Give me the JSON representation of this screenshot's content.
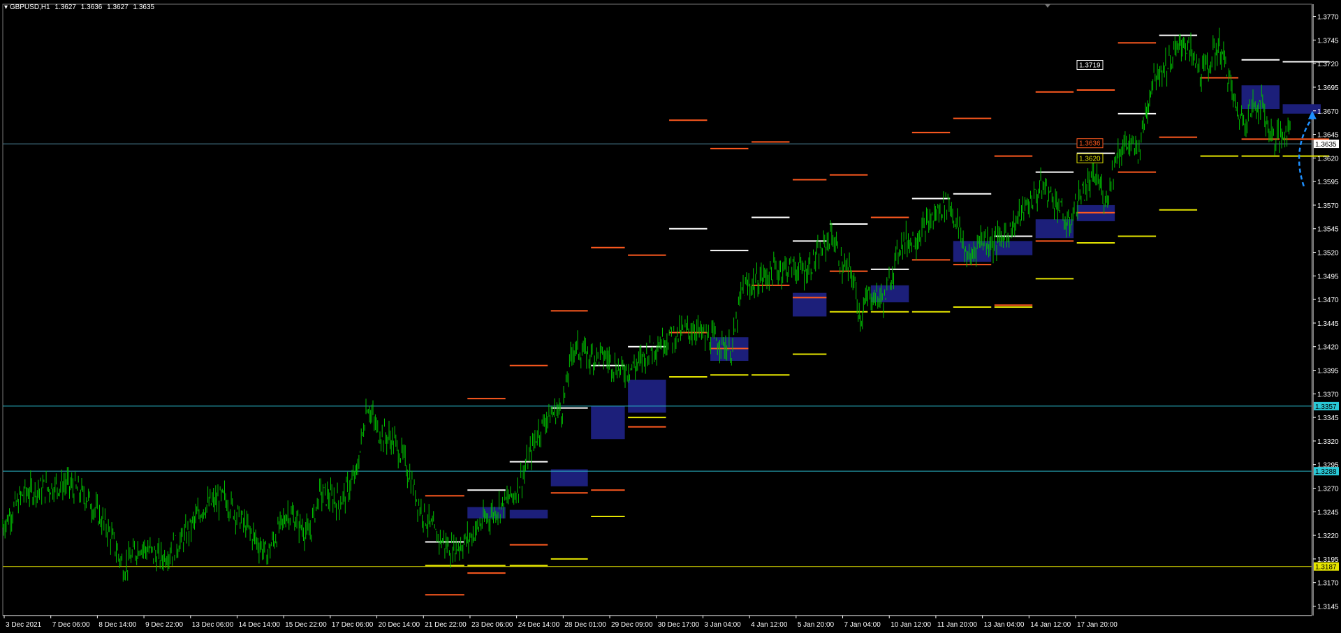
{
  "header": {
    "symbol": "GBPUSD,H1",
    "open": "1.3627",
    "high": "1.3636",
    "low": "1.3627",
    "close": "1.3635"
  },
  "colors": {
    "background": "#000000",
    "candles": "#00c000",
    "axis": "#ffffff",
    "hline_cyan": "#29b6c8",
    "hline_yellow": "#e5e500",
    "level_white": "#ffffff",
    "level_orange": "#ff5a1f",
    "level_yellow": "#e5e500",
    "zone": "#1c1f7a",
    "arrow": "#1e90ff"
  },
  "chart_data": {
    "type": "candlestick",
    "instrument": "GBPUSD",
    "timeframe": "H1",
    "y_ticks": [
      "1.3770",
      "1.3745",
      "1.3720",
      "1.3695",
      "1.3670",
      "1.3645",
      "1.3620",
      "1.3595",
      "1.3570",
      "1.3545",
      "1.3520",
      "1.3495",
      "1.3470",
      "1.3445",
      "1.3420",
      "1.3395",
      "1.3370",
      "1.3345",
      "1.3320",
      "1.3295",
      "1.3270",
      "1.3245",
      "1.3220",
      "1.3195",
      "1.3170",
      "1.3145"
    ],
    "y_range": [
      1.3135,
      1.3783
    ],
    "x_ticks": [
      "3 Dec 2021",
      "7 Dec 06:00",
      "8 Dec 14:00",
      "9 Dec 22:00",
      "13 Dec 06:00",
      "14 Dec 14:00",
      "15 Dec 22:00",
      "17 Dec 06:00",
      "20 Dec 14:00",
      "21 Dec 22:00",
      "23 Dec 06:00",
      "24 Dec 14:00",
      "28 Dec 01:00",
      "29 Dec 09:00",
      "30 Dec 17:00",
      "3 Jan 04:00",
      "4 Jan 12:00",
      "5 Jan 20:00",
      "7 Jan 04:00",
      "10 Jan 12:00",
      "11 Jan 20:00",
      "13 Jan 04:00",
      "14 Jan 12:00",
      "17 Jan 20:00"
    ],
    "price_path": [
      {
        "x": 0,
        "y": 1.323
      },
      {
        "x": 20,
        "y": 1.3265
      },
      {
        "x": 40,
        "y": 1.327
      },
      {
        "x": 60,
        "y": 1.3275
      },
      {
        "x": 80,
        "y": 1.326
      },
      {
        "x": 100,
        "y": 1.3225
      },
      {
        "x": 115,
        "y": 1.3185
      },
      {
        "x": 130,
        "y": 1.321
      },
      {
        "x": 150,
        "y": 1.3195
      },
      {
        "x": 170,
        "y": 1.3215
      },
      {
        "x": 190,
        "y": 1.325
      },
      {
        "x": 210,
        "y": 1.326
      },
      {
        "x": 230,
        "y": 1.323
      },
      {
        "x": 250,
        "y": 1.32
      },
      {
        "x": 270,
        "y": 1.3245
      },
      {
        "x": 290,
        "y": 1.322
      },
      {
        "x": 300,
        "y": 1.3265
      },
      {
        "x": 320,
        "y": 1.3255
      },
      {
        "x": 335,
        "y": 1.3285
      },
      {
        "x": 345,
        "y": 1.336
      },
      {
        "x": 355,
        "y": 1.333
      },
      {
        "x": 370,
        "y": 1.332
      },
      {
        "x": 380,
        "y": 1.33
      },
      {
        "x": 395,
        "y": 1.325
      },
      {
        "x": 410,
        "y": 1.322
      },
      {
        "x": 425,
        "y": 1.3205
      },
      {
        "x": 440,
        "y": 1.3215
      },
      {
        "x": 455,
        "y": 1.3235
      },
      {
        "x": 470,
        "y": 1.325
      },
      {
        "x": 485,
        "y": 1.3265
      },
      {
        "x": 495,
        "y": 1.329
      },
      {
        "x": 505,
        "y": 1.3325
      },
      {
        "x": 515,
        "y": 1.3345
      },
      {
        "x": 530,
        "y": 1.3355
      },
      {
        "x": 540,
        "y": 1.342
      },
      {
        "x": 555,
        "y": 1.341
      },
      {
        "x": 570,
        "y": 1.341
      },
      {
        "x": 585,
        "y": 1.3395
      },
      {
        "x": 600,
        "y": 1.34
      },
      {
        "x": 615,
        "y": 1.342
      },
      {
        "x": 630,
        "y": 1.343
      },
      {
        "x": 645,
        "y": 1.3435
      },
      {
        "x": 655,
        "y": 1.344
      },
      {
        "x": 665,
        "y": 1.343
      },
      {
        "x": 680,
        "y": 1.3425
      },
      {
        "x": 690,
        "y": 1.3415
      },
      {
        "x": 700,
        "y": 1.348
      },
      {
        "x": 715,
        "y": 1.349
      },
      {
        "x": 730,
        "y": 1.35
      },
      {
        "x": 745,
        "y": 1.3505
      },
      {
        "x": 760,
        "y": 1.35
      },
      {
        "x": 775,
        "y": 1.352
      },
      {
        "x": 785,
        "y": 1.354
      },
      {
        "x": 795,
        "y": 1.3505
      },
      {
        "x": 805,
        "y": 1.3495
      },
      {
        "x": 812,
        "y": 1.345
      },
      {
        "x": 820,
        "y": 1.3475
      },
      {
        "x": 835,
        "y": 1.347
      },
      {
        "x": 850,
        "y": 1.353
      },
      {
        "x": 865,
        "y": 1.3535
      },
      {
        "x": 880,
        "y": 1.3555
      },
      {
        "x": 895,
        "y": 1.3575
      },
      {
        "x": 905,
        "y": 1.3545
      },
      {
        "x": 915,
        "y": 1.351
      },
      {
        "x": 925,
        "y": 1.3535
      },
      {
        "x": 940,
        "y": 1.353
      },
      {
        "x": 955,
        "y": 1.3545
      },
      {
        "x": 970,
        "y": 1.357
      },
      {
        "x": 985,
        "y": 1.359
      },
      {
        "x": 1000,
        "y": 1.357
      },
      {
        "x": 1008,
        "y": 1.3545
      },
      {
        "x": 1020,
        "y": 1.358
      },
      {
        "x": 1035,
        "y": 1.36
      },
      {
        "x": 1045,
        "y": 1.3575
      },
      {
        "x": 1055,
        "y": 1.3625
      },
      {
        "x": 1065,
        "y": 1.3635
      },
      {
        "x": 1075,
        "y": 1.3625
      },
      {
        "x": 1082,
        "y": 1.3665
      },
      {
        "x": 1090,
        "y": 1.371
      },
      {
        "x": 1100,
        "y": 1.3715
      },
      {
        "x": 1110,
        "y": 1.373
      },
      {
        "x": 1118,
        "y": 1.3745
      },
      {
        "x": 1125,
        "y": 1.373
      },
      {
        "x": 1135,
        "y": 1.371
      },
      {
        "x": 1145,
        "y": 1.3725
      },
      {
        "x": 1152,
        "y": 1.374
      },
      {
        "x": 1160,
        "y": 1.371
      },
      {
        "x": 1168,
        "y": 1.367
      },
      {
        "x": 1175,
        "y": 1.366
      },
      {
        "x": 1185,
        "y": 1.3675
      },
      {
        "x": 1192,
        "y": 1.368
      },
      {
        "x": 1200,
        "y": 1.3645
      },
      {
        "x": 1210,
        "y": 1.364
      },
      {
        "x": 1215,
        "y": 1.365
      },
      {
        "x": 1220,
        "y": 1.3655
      }
    ],
    "horizontal_lines": [
      {
        "price": 1.3635,
        "label": "1.3635",
        "style": "current"
      },
      {
        "price": 1.3357,
        "label": "1.3357",
        "style": "cyan"
      },
      {
        "price": 1.3288,
        "label": "1.3288",
        "style": "cyan"
      },
      {
        "price": 1.3187,
        "label": "1.3187",
        "style": "yellow"
      }
    ],
    "price_labels": [
      {
        "price": 1.3719,
        "text": "1.3719",
        "style": "white"
      },
      {
        "price": 1.3636,
        "text": "1.3636",
        "style": "orange"
      },
      {
        "price": 1.362,
        "text": "1.3620",
        "style": "yellow"
      }
    ],
    "levels": [
      {
        "x0": 400,
        "x1": 437,
        "price": 1.3213,
        "c": "w"
      },
      {
        "x0": 400,
        "x1": 437,
        "price": 1.3262,
        "c": "o"
      },
      {
        "x0": 400,
        "x1": 437,
        "price": 1.3157,
        "c": "o"
      },
      {
        "x0": 400,
        "x1": 437,
        "price": 1.3188,
        "c": "y"
      },
      {
        "x0": 440,
        "x1": 476,
        "price": 1.3268,
        "c": "w"
      },
      {
        "x0": 440,
        "x1": 476,
        "price": 1.3365,
        "c": "o"
      },
      {
        "x0": 440,
        "x1": 476,
        "price": 1.318,
        "c": "o"
      },
      {
        "x0": 440,
        "x1": 476,
        "price": 1.3188,
        "c": "y"
      },
      {
        "x0": 480,
        "x1": 516,
        "price": 1.3298,
        "c": "w"
      },
      {
        "x0": 480,
        "x1": 516,
        "price": 1.34,
        "c": "o"
      },
      {
        "x0": 480,
        "x1": 516,
        "price": 1.321,
        "c": "o"
      },
      {
        "x0": 480,
        "x1": 516,
        "price": 1.3188,
        "c": "y"
      },
      {
        "x0": 519,
        "x1": 554,
        "price": 1.3355,
        "c": "w"
      },
      {
        "x0": 519,
        "x1": 554,
        "price": 1.3458,
        "c": "o"
      },
      {
        "x0": 519,
        "x1": 554,
        "price": 1.3265,
        "c": "o"
      },
      {
        "x0": 519,
        "x1": 554,
        "price": 1.3195,
        "c": "y"
      },
      {
        "x0": 557,
        "x1": 589,
        "price": 1.34,
        "c": "w"
      },
      {
        "x0": 557,
        "x1": 589,
        "price": 1.3525,
        "c": "o"
      },
      {
        "x0": 557,
        "x1": 589,
        "price": 1.3268,
        "c": "o"
      },
      {
        "x0": 557,
        "x1": 589,
        "price": 1.324,
        "c": "y"
      },
      {
        "x0": 592,
        "x1": 628,
        "price": 1.342,
        "c": "w"
      },
      {
        "x0": 592,
        "x1": 628,
        "price": 1.3517,
        "c": "o"
      },
      {
        "x0": 592,
        "x1": 628,
        "price": 1.3335,
        "c": "o"
      },
      {
        "x0": 592,
        "x1": 628,
        "price": 1.3345,
        "c": "y"
      },
      {
        "x0": 631,
        "x1": 667,
        "price": 1.3545,
        "c": "w"
      },
      {
        "x0": 631,
        "x1": 667,
        "price": 1.366,
        "c": "o"
      },
      {
        "x0": 631,
        "x1": 667,
        "price": 1.3435,
        "c": "o"
      },
      {
        "x0": 631,
        "x1": 667,
        "price": 1.3388,
        "c": "y"
      },
      {
        "x0": 670,
        "x1": 706,
        "price": 1.3522,
        "c": "w"
      },
      {
        "x0": 670,
        "x1": 706,
        "price": 1.363,
        "c": "o"
      },
      {
        "x0": 670,
        "x1": 706,
        "price": 1.3418,
        "c": "o"
      },
      {
        "x0": 670,
        "x1": 706,
        "price": 1.339,
        "c": "y"
      },
      {
        "x0": 709,
        "x1": 745,
        "price": 1.3557,
        "c": "w"
      },
      {
        "x0": 709,
        "x1": 745,
        "price": 1.3637,
        "c": "o"
      },
      {
        "x0": 709,
        "x1": 745,
        "price": 1.3485,
        "c": "o"
      },
      {
        "x0": 709,
        "x1": 745,
        "price": 1.339,
        "c": "y"
      },
      {
        "x0": 748,
        "x1": 780,
        "price": 1.3532,
        "c": "w"
      },
      {
        "x0": 748,
        "x1": 780,
        "price": 1.3597,
        "c": "o"
      },
      {
        "x0": 748,
        "x1": 780,
        "price": 1.3472,
        "c": "o"
      },
      {
        "x0": 748,
        "x1": 780,
        "price": 1.3412,
        "c": "y"
      },
      {
        "x0": 783,
        "x1": 819,
        "price": 1.355,
        "c": "w"
      },
      {
        "x0": 783,
        "x1": 819,
        "price": 1.3602,
        "c": "o"
      },
      {
        "x0": 783,
        "x1": 819,
        "price": 1.35,
        "c": "o"
      },
      {
        "x0": 783,
        "x1": 819,
        "price": 1.3457,
        "c": "y"
      },
      {
        "x0": 822,
        "x1": 858,
        "price": 1.3502,
        "c": "w"
      },
      {
        "x0": 822,
        "x1": 858,
        "price": 1.3557,
        "c": "o"
      },
      {
        "x0": 822,
        "x1": 858,
        "price": 1.3457,
        "c": "y"
      },
      {
        "x0": 861,
        "x1": 897,
        "price": 1.3577,
        "c": "w"
      },
      {
        "x0": 861,
        "x1": 897,
        "price": 1.3647,
        "c": "o"
      },
      {
        "x0": 861,
        "x1": 897,
        "price": 1.3512,
        "c": "o"
      },
      {
        "x0": 861,
        "x1": 897,
        "price": 1.3457,
        "c": "y"
      },
      {
        "x0": 900,
        "x1": 936,
        "price": 1.3582,
        "c": "w"
      },
      {
        "x0": 900,
        "x1": 936,
        "price": 1.3662,
        "c": "o"
      },
      {
        "x0": 900,
        "x1": 936,
        "price": 1.3507,
        "c": "o"
      },
      {
        "x0": 900,
        "x1": 936,
        "price": 1.3462,
        "c": "y"
      },
      {
        "x0": 939,
        "x1": 975,
        "price": 1.3537,
        "c": "w"
      },
      {
        "x0": 939,
        "x1": 975,
        "price": 1.3622,
        "c": "o"
      },
      {
        "x0": 939,
        "x1": 975,
        "price": 1.3464,
        "c": "o"
      },
      {
        "x0": 939,
        "x1": 975,
        "price": 1.3462,
        "c": "y"
      },
      {
        "x0": 978,
        "x1": 1014,
        "price": 1.3605,
        "c": "w"
      },
      {
        "x0": 978,
        "x1": 1014,
        "price": 1.369,
        "c": "o"
      },
      {
        "x0": 978,
        "x1": 1014,
        "price": 1.3532,
        "c": "o"
      },
      {
        "x0": 978,
        "x1": 1014,
        "price": 1.3492,
        "c": "y"
      },
      {
        "x0": 1017,
        "x1": 1053,
        "price": 1.3625,
        "c": "w"
      },
      {
        "x0": 1017,
        "x1": 1053,
        "price": 1.3692,
        "c": "o"
      },
      {
        "x0": 1017,
        "x1": 1053,
        "price": 1.3562,
        "c": "o"
      },
      {
        "x0": 1017,
        "x1": 1053,
        "price": 1.353,
        "c": "y"
      },
      {
        "x0": 1056,
        "x1": 1092,
        "price": 1.3667,
        "c": "w"
      },
      {
        "x0": 1056,
        "x1": 1092,
        "price": 1.3742,
        "c": "o"
      },
      {
        "x0": 1056,
        "x1": 1092,
        "price": 1.3605,
        "c": "o"
      },
      {
        "x0": 1056,
        "x1": 1092,
        "price": 1.3537,
        "c": "y"
      },
      {
        "x0": 1095,
        "x1": 1131,
        "price": 1.375,
        "c": "w"
      },
      {
        "x0": 1095,
        "x1": 1131,
        "price": 1.3642,
        "c": "o"
      },
      {
        "x0": 1095,
        "x1": 1131,
        "price": 1.3565,
        "c": "y"
      },
      {
        "x0": 1134,
        "x1": 1170,
        "price": 1.3705,
        "c": "o"
      },
      {
        "x0": 1134,
        "x1": 1170,
        "price": 1.3622,
        "c": "y"
      },
      {
        "x0": 1173,
        "x1": 1209,
        "price": 1.3724,
        "c": "w"
      },
      {
        "x0": 1173,
        "x1": 1209,
        "price": 1.364,
        "c": "o"
      },
      {
        "x0": 1173,
        "x1": 1209,
        "price": 1.3622,
        "c": "y"
      },
      {
        "x0": 1212,
        "x1": 1256,
        "price": 1.3722,
        "c": "w"
      },
      {
        "x0": 1212,
        "x1": 1256,
        "price": 1.364,
        "c": "o"
      },
      {
        "x0": 1212,
        "x1": 1256,
        "price": 1.3622,
        "c": "y"
      }
    ],
    "zones": [
      {
        "x0": 440,
        "x1": 476,
        "p0": 1.325,
        "p1": 1.3238
      },
      {
        "x0": 480,
        "x1": 516,
        "p0": 1.3247,
        "p1": 1.3238
      },
      {
        "x0": 519,
        "x1": 554,
        "p0": 1.329,
        "p1": 1.3272
      },
      {
        "x0": 557,
        "x1": 589,
        "p0": 1.3357,
        "p1": 1.3322
      },
      {
        "x0": 592,
        "x1": 628,
        "p0": 1.3385,
        "p1": 1.335
      },
      {
        "x0": 670,
        "x1": 706,
        "p0": 1.343,
        "p1": 1.3405
      },
      {
        "x0": 748,
        "x1": 780,
        "p0": 1.3477,
        "p1": 1.3452
      },
      {
        "x0": 822,
        "x1": 858,
        "p0": 1.3485,
        "p1": 1.3467
      },
      {
        "x0": 900,
        "x1": 936,
        "p0": 1.3532,
        "p1": 1.351
      },
      {
        "x0": 939,
        "x1": 975,
        "p0": 1.3532,
        "p1": 1.3517
      },
      {
        "x0": 978,
        "x1": 1014,
        "p0": 1.3555,
        "p1": 1.3535
      },
      {
        "x0": 1017,
        "x1": 1053,
        "p0": 1.357,
        "p1": 1.3553
      },
      {
        "x0": 1173,
        "x1": 1209,
        "p0": 1.3697,
        "p1": 1.3672
      },
      {
        "x0": 1212,
        "x1": 1248,
        "p0": 1.3677,
        "p1": 1.3667
      }
    ],
    "arrow": {
      "from": {
        "x": 1232,
        "price": 1.359
      },
      "to": {
        "x": 1240,
        "price": 1.367
      }
    }
  }
}
